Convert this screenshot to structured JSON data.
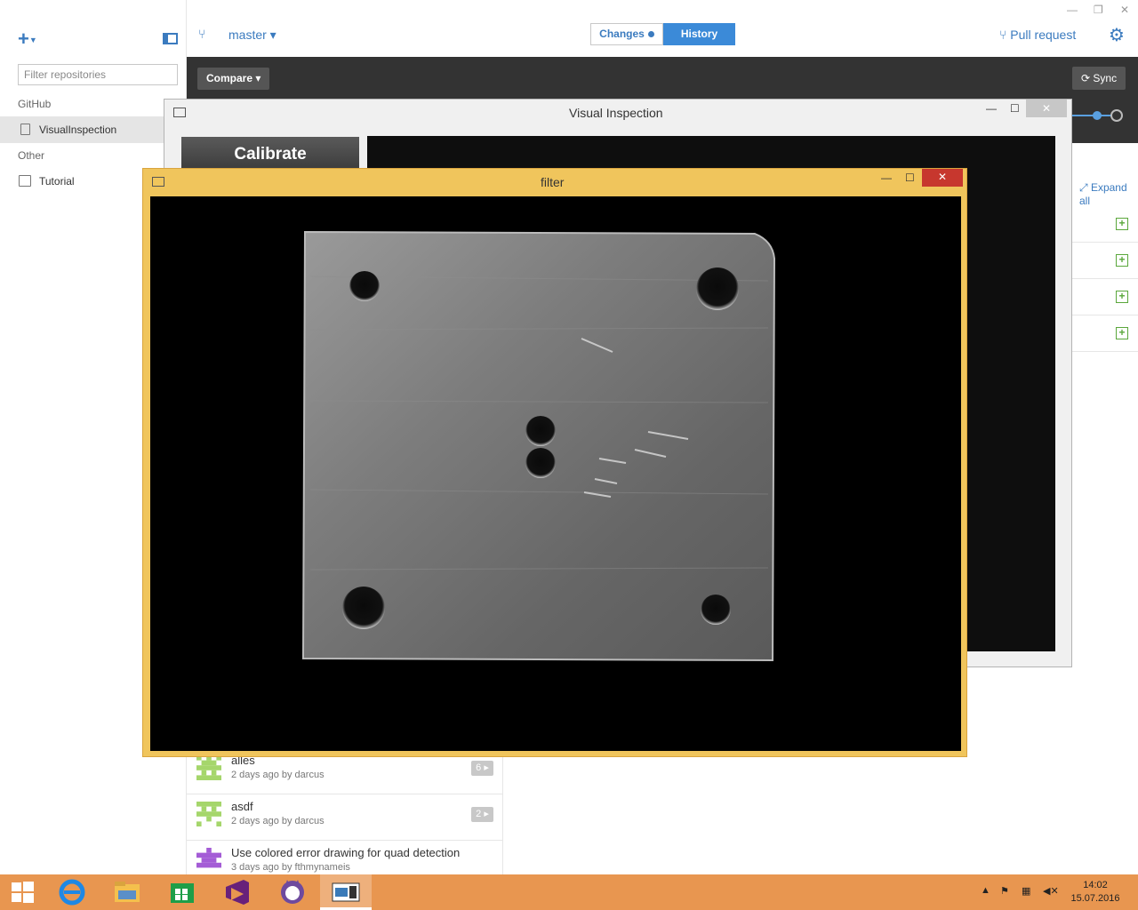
{
  "sidebar": {
    "filter_placeholder": "Filter repositories",
    "groups": [
      {
        "label": "GitHub",
        "items": [
          {
            "label": "VisualInspection",
            "active": true
          }
        ]
      },
      {
        "label": "Other",
        "items": [
          {
            "label": "Tutorial",
            "active": false
          }
        ]
      }
    ]
  },
  "topbar": {
    "branch": "master ▾",
    "changes_label": "Changes",
    "history_label": "History",
    "pull_request": "Pull request",
    "minimize": "—",
    "restore": "❐",
    "close": "✕"
  },
  "toolbar": {
    "compare_label": "Compare ▾",
    "sync_label": "Sync"
  },
  "expand_all": "Expand all",
  "commits": [
    {
      "message": "alles",
      "meta": "2 days ago by darcus",
      "count": "6 ▸",
      "avatar_color": "#8bc34a"
    },
    {
      "message": "asdf",
      "meta": "2 days ago by darcus",
      "count": "2 ▸",
      "avatar_color": "#8bc34a"
    },
    {
      "message": "Use colored error drawing for quad detection",
      "meta": "3 days ago by fthmynameis",
      "count": "",
      "avatar_color": "#9c4fc9"
    }
  ],
  "visual_inspection": {
    "title": "Visual Inspection",
    "calibrate_label": "Calibrate",
    "minimize": "—",
    "maximize": "☐",
    "close": "✕"
  },
  "filter_window": {
    "title": "filter",
    "minimize": "—",
    "maximize": "☐",
    "close": "✕"
  },
  "taskbar": {
    "time": "14:02",
    "date": "15.07.2016"
  },
  "colors": {
    "accent": "#3b7bbf",
    "taskbar": "#e89650",
    "filter_frame": "#f0c55c"
  }
}
